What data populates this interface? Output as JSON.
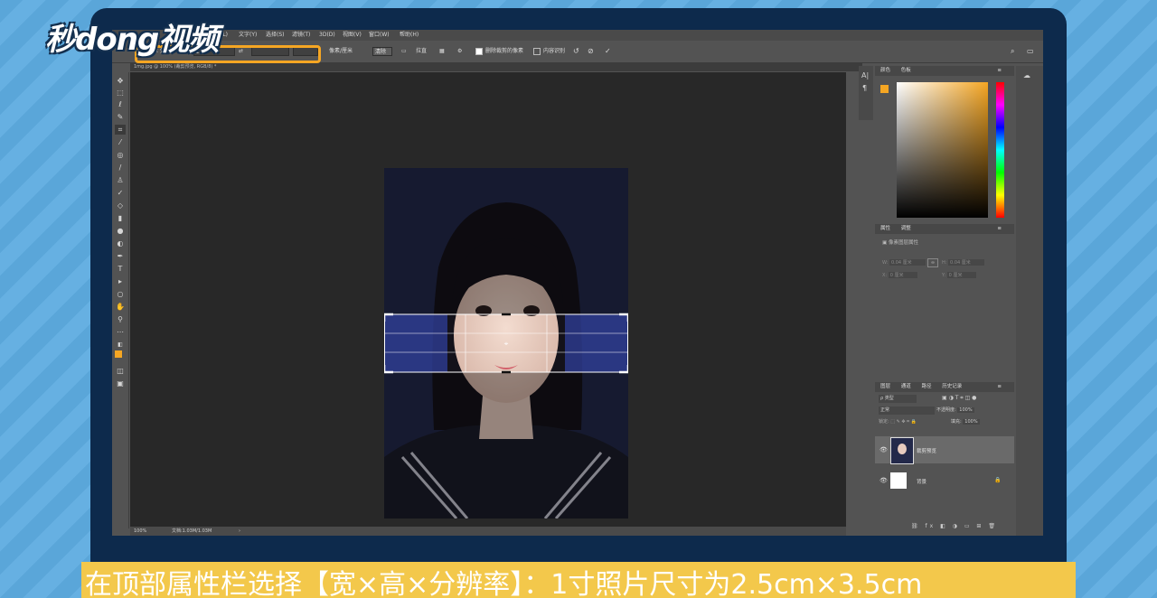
{
  "logo": {
    "text": "秒dong视频"
  },
  "menu": [
    "图层(L)",
    "文字(Y)",
    "选择(S)",
    "滤镜(T)",
    "3D(D)",
    "视图(V)",
    "窗口(W)",
    "帮助(H)"
  ],
  "options": {
    "preset": "宽 x 高 x 分...",
    "width_value": "2.5",
    "swap_icon": "swap-icon",
    "unit_select": "像素/厘米",
    "clear_label": "清除",
    "straighten_label": "拉直",
    "delete_cropped_label": "删除裁剪的像素",
    "content_aware_label": "内容识别"
  },
  "document": {
    "tab": "1mg.jpg @ 100% (裁剪预览, RGB/8) *"
  },
  "status": {
    "zoom": "100%",
    "doc": "文档:1.03M/1.03M"
  },
  "color_panel": {
    "tabs": [
      "颜色",
      "色板"
    ]
  },
  "properties_panel": {
    "tabs": [
      "属性",
      "调整"
    ],
    "title": "像素图层属性",
    "w_label": "W:",
    "w_value": "0.04 厘米",
    "h_label": "H:",
    "h_value": "0.04 厘米",
    "x_label": "X:",
    "x_value": "0 厘米",
    "y_label": "Y:",
    "y_value": "0 厘米"
  },
  "layers_panel": {
    "tabs": [
      "图层",
      "通道",
      "路径",
      "历史记录"
    ],
    "kind": "ρ 类型",
    "blend_mode": "正常",
    "opacity_label": "不透明度:",
    "opacity_value": "100%",
    "lock_label": "锁定:",
    "fill_label": "填充:",
    "fill_value": "100%",
    "layers": [
      {
        "name": "裁剪预览"
      },
      {
        "name": "背景"
      }
    ]
  },
  "subtitle": "在顶部属性栏选择【宽×高×分辨率】：1寸照片尺寸为2.5cm×3.5cm",
  "colors": {
    "accent": "#f5a623",
    "photo_bg": "#23294a",
    "crop_overlay": "#2b3a8c"
  }
}
